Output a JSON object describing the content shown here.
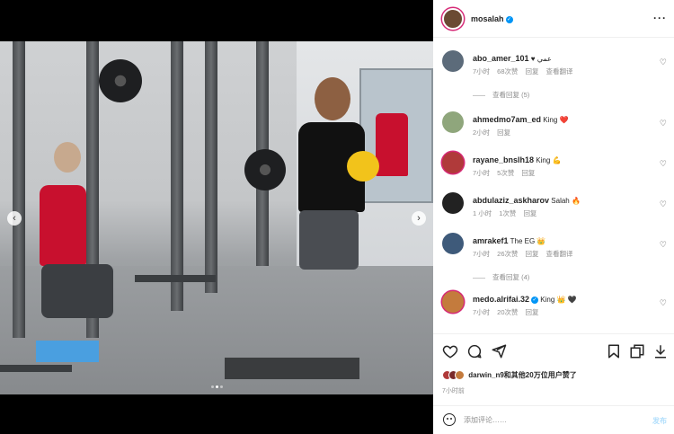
{
  "post": {
    "author": "mosalah",
    "more_icon": "more-horizontal-icon"
  },
  "comments": [
    {
      "username": "abo_amer_101",
      "text": "♥ عمي",
      "time": "7小时",
      "likes": "68次赞",
      "reply": "回复",
      "translate": "查看翻译",
      "avatar_color": "#5c6b7a"
    },
    {
      "username": "ahmedmo7am_ed",
      "text": "King ❤️",
      "time": "2小时",
      "likes": "",
      "reply": "回复",
      "translate": "",
      "avatar_color": "#8fa67c"
    },
    {
      "username": "rayane_bnslh18",
      "text": "King 💪",
      "time": "7小时",
      "likes": "5次赞",
      "reply": "回复",
      "translate": "",
      "avatar_color": "#b03a3a"
    },
    {
      "username": "abdulaziz_askharov",
      "text": "Salah 🔥",
      "time": "1 小时",
      "likes": "1次赞",
      "reply": "回复",
      "translate": "",
      "avatar_color": "#222222"
    },
    {
      "username": "amrakef1",
      "text": "The EG 👑",
      "time": "7小时",
      "likes": "26次赞",
      "reply": "回复",
      "translate": "查看翻译",
      "avatar_color": "#3e5a7a"
    },
    {
      "username": "medo.alrifai.32",
      "text": "King 👑 🖤",
      "time": "7小时",
      "likes": "20次赞",
      "reply": "回复",
      "translate": "",
      "avatar_color": "#c47b3d"
    }
  ],
  "replies": [
    {
      "label": "查看回复 (5)"
    },
    {
      "label": "查看回复 (4)"
    }
  ],
  "actions": {
    "like": "heart-icon",
    "comment": "comment-icon",
    "share": "send-icon",
    "save": "bookmark-icon",
    "copy": "copy-icon",
    "download": "download-icon"
  },
  "likes_summary": {
    "text": "darwin_n9和其他20万位用户赞了"
  },
  "posted_time": "7小时前",
  "add_comment": {
    "placeholder": "添加评论……",
    "post_label": "发布"
  },
  "colors": {
    "accent": "#0095f6",
    "story_ring": "#d62976",
    "jersey_red": "#c8102e"
  }
}
